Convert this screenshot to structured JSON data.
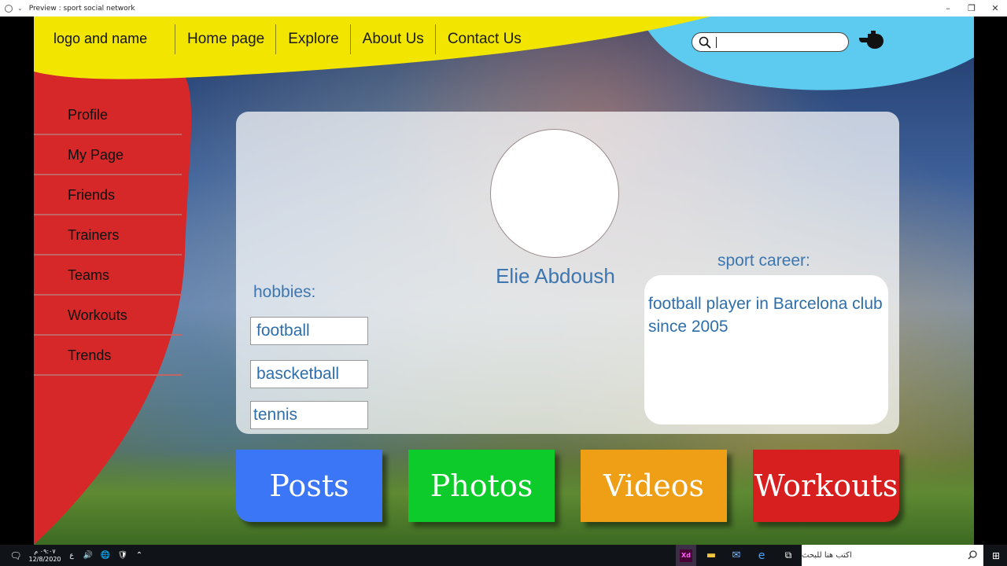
{
  "window": {
    "title": "Preview : sport social network",
    "controls": [
      "minimize",
      "restore",
      "close"
    ]
  },
  "header": {
    "logo_text": "logo and name",
    "nav": [
      "Home page",
      "Explore",
      "About Us",
      "Contact Us"
    ],
    "search": {
      "value": "",
      "placeholder": ""
    },
    "colors": {
      "yellow": "#f2e600",
      "blue": "#5ccbef"
    }
  },
  "sidebar": {
    "items": [
      "Profile",
      "My Page",
      "Friends",
      "Trainers",
      "Teams",
      "Workouts",
      "Trends"
    ],
    "color": "#d62828"
  },
  "profile": {
    "name": "Elie Abdoush",
    "hobbies_label": "hobbies:",
    "hobbies": [
      "football",
      "bascketball",
      "tennis"
    ],
    "career_label": "sport career:",
    "career_text": "football player in Barcelona club since 2005"
  },
  "actions": [
    {
      "label": "Posts",
      "color": "#3a76f5"
    },
    {
      "label": "Photos",
      "color": "#0ecb2c"
    },
    {
      "label": "Videos",
      "color": "#ef9f16"
    },
    {
      "label": "Workouts",
      "color": "#d81f1f"
    }
  ],
  "taskbar": {
    "time": "٠٩:٠٧ م",
    "date": "12/8/2020",
    "lang": "ع",
    "search_placeholder": "اكتب هنا للبحث",
    "apps": [
      "Xd",
      "file-explorer",
      "mail",
      "edge",
      "task-view"
    ]
  }
}
